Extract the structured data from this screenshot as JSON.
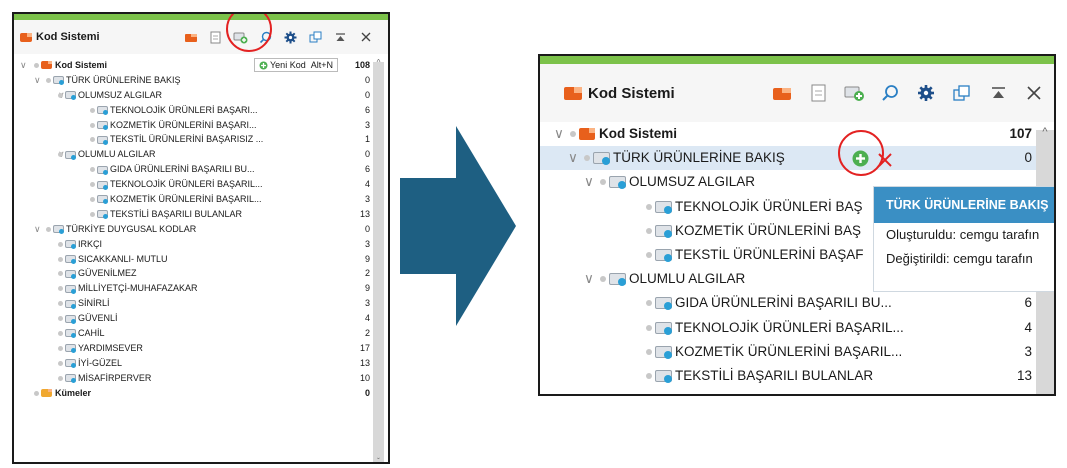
{
  "colors": {
    "accent": "#7cc24a",
    "code_system_orange": "#e8601c",
    "code_blue": "#2a9fd6",
    "highlight_red": "#e32222",
    "tooltip_header": "#3a8fc4",
    "arrow": "#1e5f82"
  },
  "left_panel": {
    "title": "Kod Sistemi",
    "tooltip": {
      "label": "Yeni Kod",
      "shortcut": "Alt+N"
    },
    "tree": [
      {
        "label": "Kod Sistemi",
        "count": "108",
        "level": 0,
        "type": "root",
        "bold": true
      },
      {
        "label": "TÜRK ÜRÜNLERİNE BAKIŞ",
        "count": "0",
        "level": 1,
        "type": "code"
      },
      {
        "label": "OLUMSUZ ALGILAR",
        "count": "0",
        "level": 2,
        "type": "code"
      },
      {
        "label": "TEKNOLOJİK ÜRÜNLERİ BAŞARI...",
        "count": "6",
        "level": 3,
        "type": "code"
      },
      {
        "label": "KOZMETİK ÜRÜNLERİNİ BAŞARI...",
        "count": "3",
        "level": 3,
        "type": "code"
      },
      {
        "label": "TEKSTİL ÜRÜNLERİNİ BAŞARISIZ ...",
        "count": "1",
        "level": 3,
        "type": "code"
      },
      {
        "label": "OLUMLU ALGILAR",
        "count": "0",
        "level": 2,
        "type": "code"
      },
      {
        "label": "GIDA ÜRÜNLERİNİ BAŞARILI BU...",
        "count": "6",
        "level": 3,
        "type": "code"
      },
      {
        "label": "TEKNOLOJİK ÜRÜNLERİ BAŞARIL...",
        "count": "4",
        "level": 3,
        "type": "code"
      },
      {
        "label": "KOZMETİK ÜRÜNLERİNİ BAŞARIL...",
        "count": "3",
        "level": 3,
        "type": "code"
      },
      {
        "label": "TEKSTİLİ BAŞARILI BULANLAR",
        "count": "13",
        "level": 3,
        "type": "code"
      },
      {
        "label": "TÜRKİYE DUYGUSAL KODLAR",
        "count": "0",
        "level": 1,
        "type": "code"
      },
      {
        "label": "IRKÇI",
        "count": "3",
        "level": 2,
        "type": "code"
      },
      {
        "label": "SICAKKANLI- MUTLU",
        "count": "9",
        "level": 2,
        "type": "code"
      },
      {
        "label": "GÜVENİLMEZ",
        "count": "2",
        "level": 2,
        "type": "code"
      },
      {
        "label": "MİLLİYETÇİ-MUHAFAZAKAR",
        "count": "9",
        "level": 2,
        "type": "code"
      },
      {
        "label": "SİNİRLİ",
        "count": "3",
        "level": 2,
        "type": "code"
      },
      {
        "label": "GÜVENLİ",
        "count": "4",
        "level": 2,
        "type": "code"
      },
      {
        "label": "CAHİL",
        "count": "2",
        "level": 2,
        "type": "code"
      },
      {
        "label": "YARDIMSEVER",
        "count": "17",
        "level": 2,
        "type": "code"
      },
      {
        "label": "İYİ-GÜZEL",
        "count": "13",
        "level": 2,
        "type": "code"
      },
      {
        "label": "MİSAFİRPERVER",
        "count": "10",
        "level": 2,
        "type": "code"
      },
      {
        "label": "Kümeler",
        "count": "0",
        "level": 0,
        "type": "set",
        "bold": true
      }
    ]
  },
  "right_panel": {
    "title": "Kod Sistemi",
    "tree": [
      {
        "label": "Kod Sistemi",
        "count": "107",
        "level": 0,
        "type": "root",
        "bold": true
      },
      {
        "label": "TÜRK ÜRÜNLERİNE BAKIŞ",
        "count": "0",
        "level": 1,
        "type": "code",
        "selected": true
      },
      {
        "label": "OLUMSUZ ALGILAR",
        "count": "",
        "level": 2,
        "type": "code"
      },
      {
        "label": "TEKNOLOJİK ÜRÜNLERİ BAŞ",
        "count": "",
        "level": 3,
        "type": "code"
      },
      {
        "label": "KOZMETİK ÜRÜNLERİNİ BAŞ",
        "count": "",
        "level": 3,
        "type": "code"
      },
      {
        "label": "TEKSTİL ÜRÜNLERİNİ BAŞAF",
        "count": "",
        "level": 3,
        "type": "code"
      },
      {
        "label": "OLUMLU ALGILAR",
        "count": "0",
        "level": 2,
        "type": "code"
      },
      {
        "label": "GIDA ÜRÜNLERİNİ BAŞARILI BU...",
        "count": "6",
        "level": 3,
        "type": "code"
      },
      {
        "label": "TEKNOLOJİK ÜRÜNLERİ BAŞARIL...",
        "count": "4",
        "level": 3,
        "type": "code"
      },
      {
        "label": "KOZMETİK ÜRÜNLERİNİ BAŞARIL...",
        "count": "3",
        "level": 3,
        "type": "code"
      },
      {
        "label": "TEKSTİLİ BAŞARILI BULANLAR",
        "count": "13",
        "level": 3,
        "type": "code"
      }
    ],
    "info_card": {
      "header": "TÜRK ÜRÜNLERİNE BAKIŞ",
      "created_label": "Oluşturuldu:",
      "created_value": "cemgu tarafın",
      "modified_label": "Değiştirildi:",
      "modified_value": "cemgu tarafın"
    }
  }
}
